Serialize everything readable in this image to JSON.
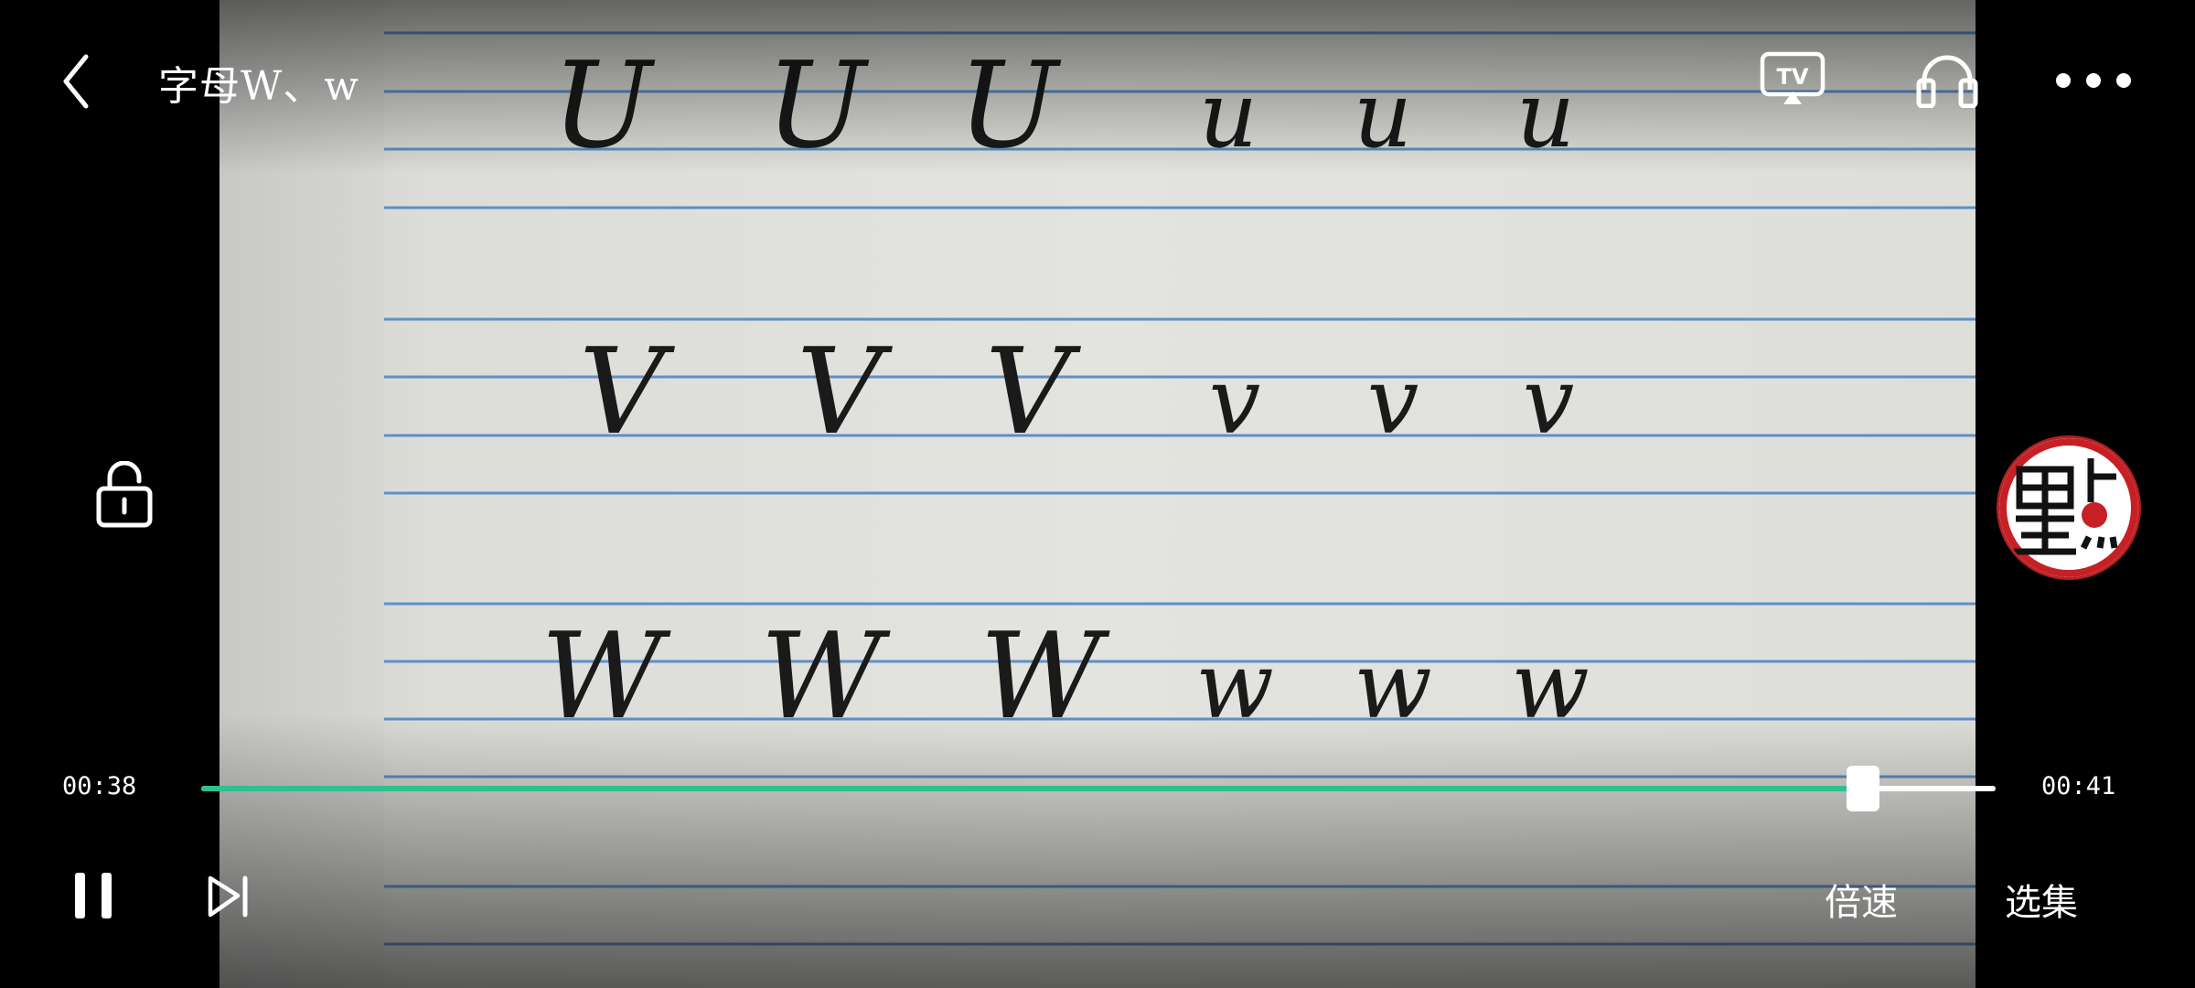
{
  "header": {
    "title": "字母W、w"
  },
  "video": {
    "letter_rows": [
      [
        "U",
        "U",
        "U",
        "u",
        "u",
        "u"
      ],
      [
        "V",
        "V",
        "V",
        "v",
        "v",
        "v"
      ],
      [
        "W",
        "W",
        "W",
        "w",
        "w",
        "w"
      ]
    ]
  },
  "player": {
    "current_time": "00:38",
    "total_time": "00:41",
    "progress": 0.926,
    "accent_color": "#2fc08f",
    "speed_label": "倍速",
    "episodes_label": "选集"
  },
  "icons": [
    "back-icon",
    "tv-cast-icon",
    "headphones-icon",
    "more-icon",
    "unlock-icon",
    "pause-icon",
    "next-icon"
  ]
}
